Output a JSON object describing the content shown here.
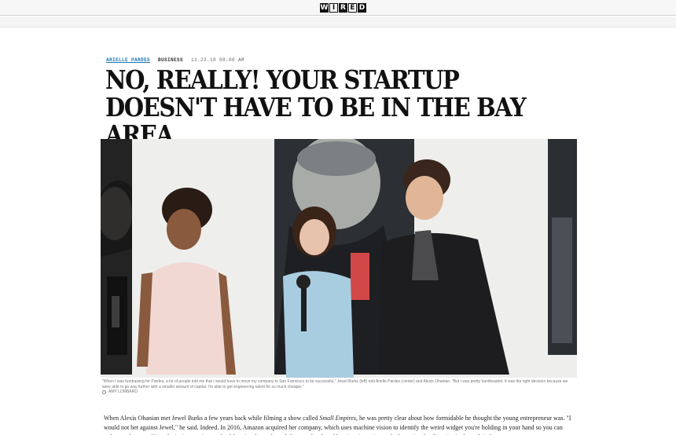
{
  "header": {
    "logo_letters": [
      "W",
      "I",
      "R",
      "E",
      "D"
    ]
  },
  "article": {
    "author": "ARIELLE PARDES",
    "section": "BUSINESS",
    "date": "11.23.18  08:00 AM",
    "headline": "NO, REALLY! YOUR STARTUP DOESN'T HAVE TO BE IN THE BAY AREA",
    "caption": "\"When I was fundraising for Pardes, a lot of people told me that I would have to move my company to San Francisco to be successful,\" Jewel Burks (left) told Arielle Pardes (center) and Alexis Ohanian. \"But I was pretty hardheaded. It was the right decision because we were able to go way further with a smaller amount of capital. I'm able to get engineering talent for so much cheaper.\"",
    "photo_credit": "AMY LOMBARD",
    "body_intro": "When Alexis Ohanian met Jewel Burks a few years back while filming a show called ",
    "body_show": "Small Empires",
    "body_rest": ", he was pretty clear about how formidable he thought the young entrepreneur was. \"I would not bet against Jewel,\" he said. Indeed. In 2016, Amazon acquired her company, which uses machine vision to identify the weird widget you're holding in your hand so you can order another one. Now she is Amazon's team lead for visual search, and she spends a lot of her time investing and advocating for diversity in the tech industry."
  },
  "colors": {
    "author_link": "#1a78b5",
    "backdrop_wall": "#efefed",
    "jacket": "#1d1d20"
  }
}
